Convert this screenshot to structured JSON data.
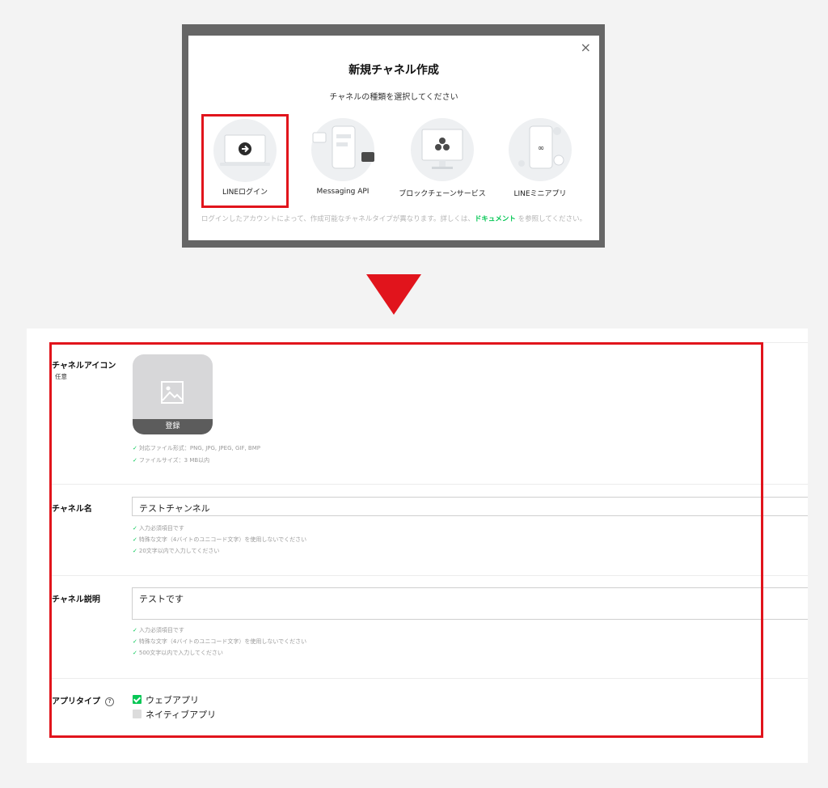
{
  "modal": {
    "title": "新規チャネル作成",
    "subtitle": "チャネルの種類を選択してください",
    "close": "×",
    "choices": [
      {
        "label": "LINEログイン"
      },
      {
        "label": "Messaging API"
      },
      {
        "label": "ブロックチェーンサービス"
      },
      {
        "label": "LINEミニアプリ"
      }
    ],
    "note_before": "ログインしたアカウントによって、作成可能なチャネルタイプが異なります。詳しくは、",
    "note_link": "ドキュメント",
    "note_after": " を参照してください。"
  },
  "form": {
    "icon": {
      "label": "チャネルアイコン",
      "optional": "任意",
      "register": "登録",
      "hints": [
        "対応ファイル形式：PNG, JPG, JPEG, GIF, BMP",
        "ファイルサイズ：3 MB以内"
      ]
    },
    "name": {
      "label": "チャネル名",
      "value": "テストチャンネル",
      "hints": [
        "入力必須項目です",
        "特殊な文字（4バイトのユニコード文字）を使用しないでください",
        "20文字以内で入力してください"
      ]
    },
    "description": {
      "label": "チャネル説明",
      "value": "テストです",
      "hints": [
        "入力必須項目です",
        "特殊な文字（4バイトのユニコード文字）を使用しないでください",
        "500文字以内で入力してください"
      ]
    },
    "app_type": {
      "label": "アプリタイプ",
      "help": "?",
      "options": [
        {
          "label": "ウェブアプリ",
          "checked": true
        },
        {
          "label": "ネイティブアプリ",
          "checked": false
        }
      ]
    }
  },
  "colors": {
    "accent": "#06c755",
    "highlight": "#e1141c"
  }
}
